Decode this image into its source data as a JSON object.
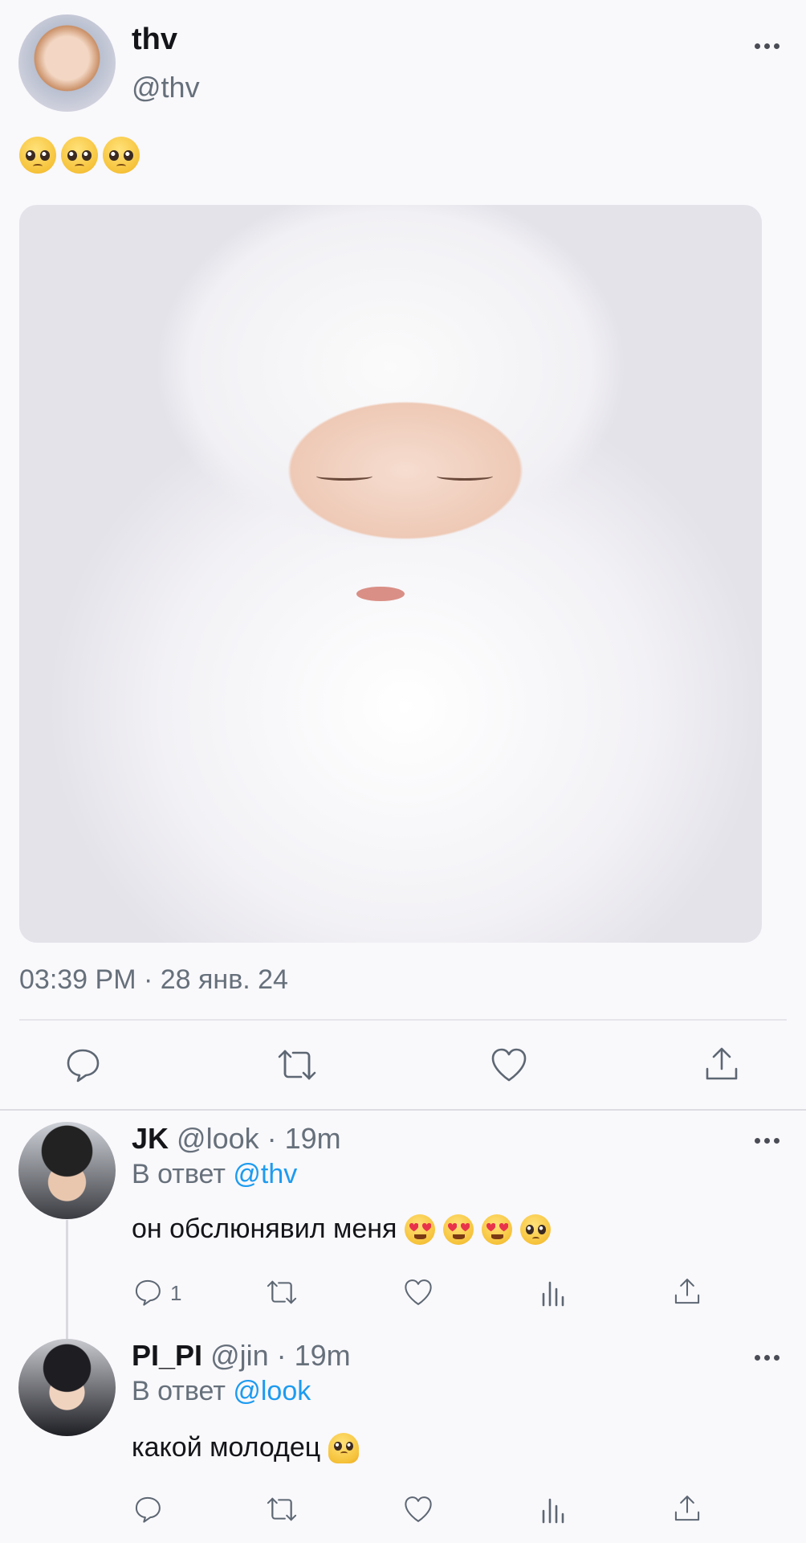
{
  "tweet": {
    "display_name": "thv",
    "handle": "@thv",
    "text_emoji": "pleading-face x3",
    "image_desc_icon": "photo-icon",
    "timestamp": "03:39 PM · 28 янв. 24"
  },
  "replies": [
    {
      "display_name": "JK",
      "handle_time": "@look · 19m",
      "reply_prefix": "В ответ",
      "reply_to": "@thv",
      "text": "он обслюнявил меня",
      "emojis": "heart-eyes x3, pleading-face",
      "reply_count": "1"
    },
    {
      "display_name": "PI_PI",
      "handle_time": "@jin · 19m",
      "reply_prefix": "В ответ",
      "reply_to": "@look",
      "text": "какой молодец",
      "emojis": "melting-face"
    }
  ],
  "colors": {
    "accent": "#1d9bf0",
    "background": "#f9f8fb",
    "icon": "#5d6773"
  }
}
